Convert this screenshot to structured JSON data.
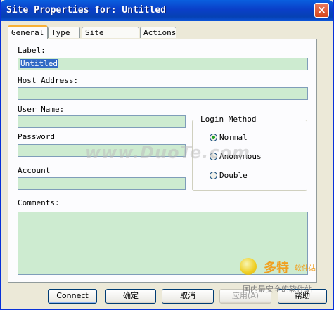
{
  "window": {
    "title": "Site Properties for: Untitled",
    "close_glyph": "×"
  },
  "tabs": [
    {
      "label": "General",
      "active": true
    },
    {
      "label": "Type",
      "active": false
    },
    {
      "label": "Site Options",
      "active": false
    },
    {
      "label": "Actions",
      "active": false
    }
  ],
  "form": {
    "label_label": "Label:",
    "label_value": "Untitled",
    "host_label": "Host Address:",
    "host_value": "",
    "user_label": "User Name:",
    "user_value": "",
    "password_label": "Password",
    "password_value": "",
    "account_label": "Account",
    "account_value": "",
    "comments_label": "Comments:",
    "comments_value": ""
  },
  "login_method": {
    "title": "Login Method",
    "options": [
      {
        "label": "Normal",
        "selected": true
      },
      {
        "label": "Anonymous",
        "selected": false
      },
      {
        "label": "Double",
        "selected": false
      }
    ]
  },
  "buttons": {
    "connect": "Connect",
    "ok": "确定",
    "cancel": "取消",
    "apply": "应用(A)",
    "help": "帮助"
  },
  "watermark": {
    "text": "www.DuoTe.com",
    "logo_main": "多特",
    "logo_small": "软件站",
    "logo_sub": "国内最安全的软件站"
  },
  "colors": {
    "field_bg": "#CDEBD0",
    "titlebar": "#0A3FC8",
    "tab_highlight": "#F8B136",
    "radio_dot": "#21A121"
  }
}
